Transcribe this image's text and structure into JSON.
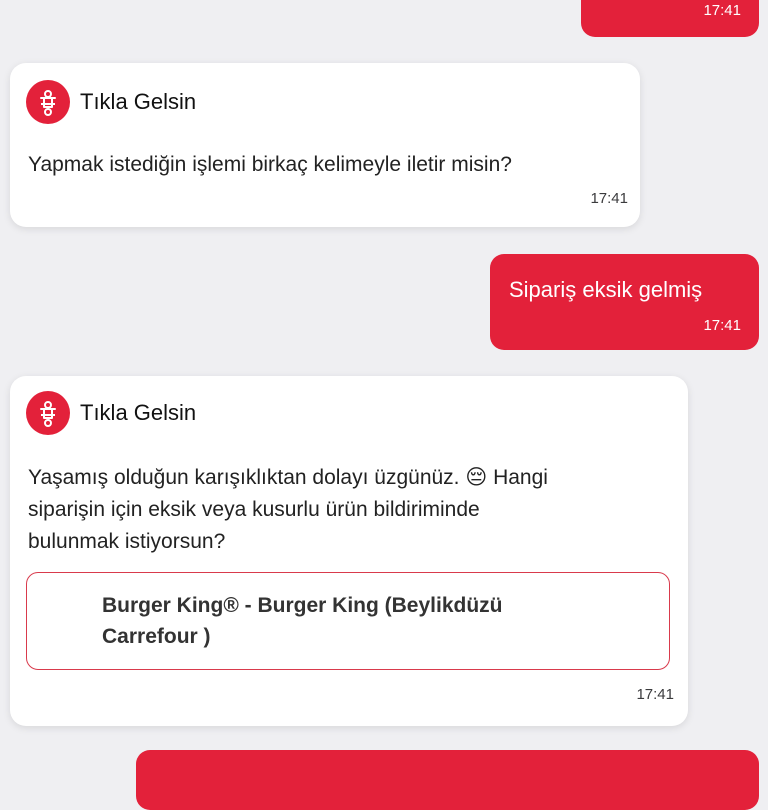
{
  "conversation": {
    "bot_name": "Tıkla Gelsin",
    "logo_icon": "scooter-icon",
    "colors": {
      "brand_red": "#e3213a",
      "card_border": "#d93a4c",
      "background": "#efeff2"
    },
    "messages": [
      {
        "sender": "user",
        "text": "",
        "time": "17:41"
      },
      {
        "sender": "bot",
        "text": "Yapmak istediğin işlemi birkaç kelimeyle iletir misin?",
        "time": "17:41"
      },
      {
        "sender": "user",
        "text": "Sipariş eksik gelmiş",
        "time": "17:41"
      },
      {
        "sender": "bot",
        "text_line1": "Yaşamış olduğun karışıklıktan dolayı üzgünüz. 😔 Hangi",
        "text_line2": "siparişin için eksik veya kusurlu ürün bildiriminde",
        "text_line3": "bulunmak istiyorsun?",
        "order_option": {
          "line1": "Burger King® - Burger King (Beylikdüzü",
          "line2": "Carrefour )"
        },
        "time": "17:41"
      },
      {
        "sender": "user",
        "text": "",
        "time": ""
      }
    ]
  }
}
